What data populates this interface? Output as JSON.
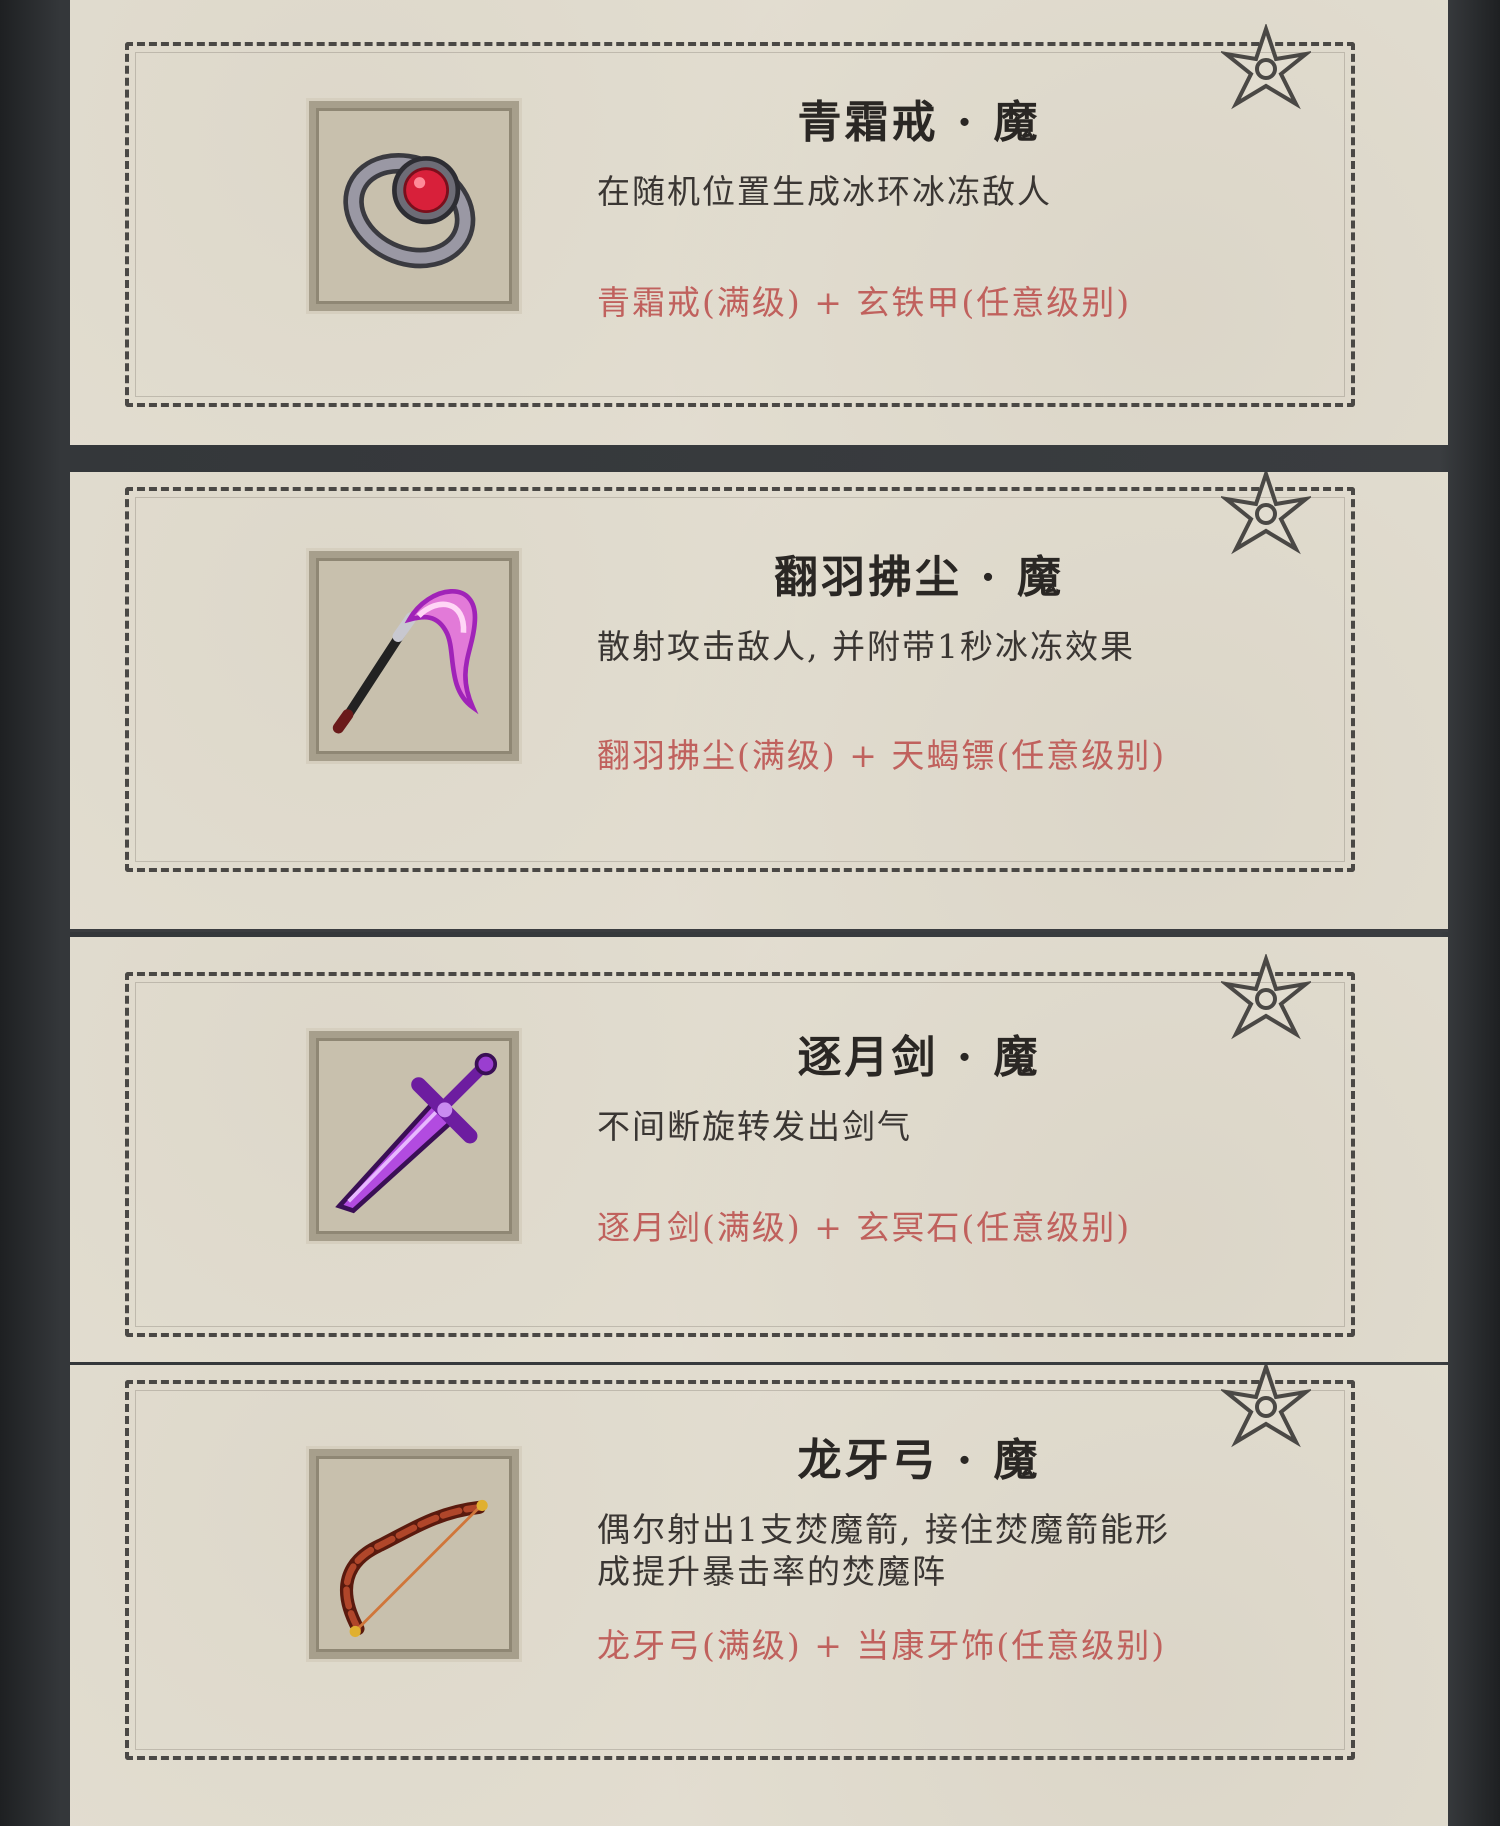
{
  "cards": [
    {
      "title": "青霜戒 · 魔",
      "description": "在随机位置生成冰环冰冻敌人",
      "recipe": "青霜戒(满级) + 玄铁甲(任意级别)",
      "icon": "ring-icon"
    },
    {
      "title": "翻羽拂尘 · 魔",
      "description": "散射攻击敌人, 并附带1秒冰冻效果",
      "recipe": "翻羽拂尘(满级) + 天蝎镖(任意级别)",
      "icon": "whisk-icon"
    },
    {
      "title": "逐月剑 · 魔",
      "description": "不间断旋转发出剑气",
      "recipe": "逐月剑(满级) + 玄冥石(任意级别)",
      "icon": "sword-icon"
    },
    {
      "title": "龙牙弓 · 魔",
      "description_line1": "偶尔射出1支焚魔箭, 接住焚魔箭能形",
      "description_line2": "成提升暴击率的焚魔阵",
      "recipe": "龙牙弓(满级) + 当康牙饰(任意级别)",
      "icon": "bow-icon"
    }
  ],
  "colors": {
    "parchment": "#e2ddd0",
    "recipe_text": "#c0615d",
    "title_text": "#2a2724"
  }
}
